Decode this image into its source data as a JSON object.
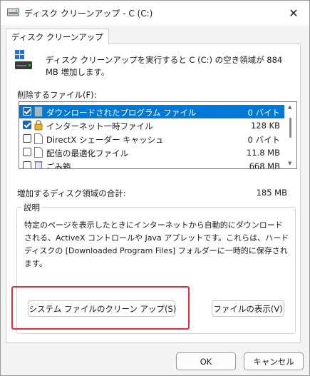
{
  "window": {
    "title": "ディスク クリーンアップ - C (C:)",
    "close_glyph": "✕"
  },
  "tab": {
    "label": "ディスク クリーンアップ"
  },
  "summary": {
    "text": "ディスク クリーンアップを実行すると C (C:) の空き領域が 884 MB 増加します。"
  },
  "files": {
    "label": "削除するファイル(F):",
    "items": [
      {
        "name": "ダウンロードされたプログラム ファイル",
        "size": "0 バイト",
        "checked": true,
        "selected": true,
        "icon": "folder-file-icon"
      },
      {
        "name": "インターネット一時ファイル",
        "size": "128 KB",
        "checked": true,
        "selected": false,
        "icon": "lock-file-icon"
      },
      {
        "name": "DirectX シェーダー キャッシュ",
        "size": "0 バイト",
        "checked": false,
        "selected": false,
        "icon": "blank-file-icon"
      },
      {
        "name": "配信の最適化ファイル",
        "size": "11.8 MB",
        "checked": false,
        "selected": false,
        "icon": "blank-file-icon"
      },
      {
        "name": "ごみ箱",
        "size": "668 MB",
        "checked": false,
        "selected": false,
        "icon": "recycle-bin-icon"
      }
    ]
  },
  "gain": {
    "label": "増加するディスク領域の合計:",
    "value": "185 MB"
  },
  "description": {
    "title": "説明",
    "text": "特定のページを表示したときにインターネットから自動的にダウンロードされる、ActiveX コントロールや Java アプレットです。これらは、ハード ディスクの [Downloaded Program Files] フォルダーに一時的に保存されます。"
  },
  "buttons": {
    "cleanup_system": "システム ファイルのクリーン アップ(S)",
    "view_files": "ファイルの表示(V)",
    "ok": "OK",
    "cancel": "キャンセル"
  },
  "colors": {
    "selection": "#0078d7",
    "highlight_box": "#e0303a",
    "checkbox_checked": "#1e63b8"
  }
}
